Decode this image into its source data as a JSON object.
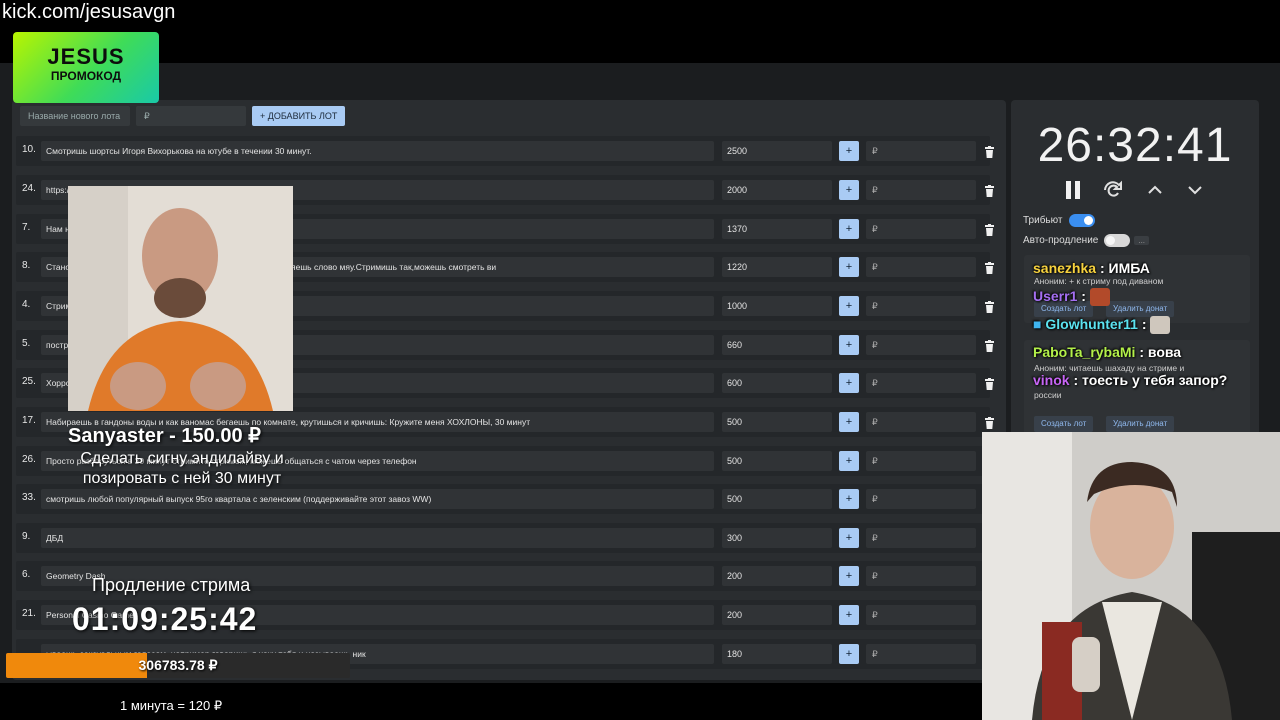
{
  "overlay": {
    "url": "kick.com/jesusavgn",
    "promo": {
      "line1": "JESUS",
      "line2": "ПРОМОКОД"
    }
  },
  "new_lot": {
    "name_placeholder": "Название нового лота",
    "amount_placeholder": "₽",
    "add_label": "+ ДОБАВИТЬ ЛОТ"
  },
  "lots": [
    {
      "rank": "10.",
      "title": "Смотришь шортсы Игоря Вихорькова на ютубе в течении 30 минут.",
      "amount": "2500",
      "plus": "+",
      "currency": "₽"
    },
    {
      "rank": "24.",
      "title": "https://",
      "amount": "2000",
      "plus": "+",
      "currency": "₽"
    },
    {
      "rank": "7.",
      "title": "Нам ну",
      "amount": "1370",
      "plus": "+",
      "currency": "₽"
    },
    {
      "rank": "8.",
      "title": "Станов                                                                                        вку и перед каждым или в конце предложения добавляешь слово мяу.Стримишь так,можешь смотреть ви",
      "amount": "1220",
      "plus": "+",
      "currency": "₽"
    },
    {
      "rank": "4.",
      "title": "Стрим",
      "amount": "1000",
      "plus": "+",
      "currency": "₽"
    },
    {
      "rank": "5.",
      "title": "постро",
      "amount": "660",
      "plus": "+",
      "currency": "₽"
    },
    {
      "rank": "25.",
      "title": "Хорро",
      "amount": "600",
      "plus": "+",
      "currency": "₽"
    },
    {
      "rank": "17.",
      "title": "Набираешь в гандоны воды и как ваномас бегаешь по комнате, крутишься и кричишь: Кружите меня ХОХЛОНЫ, 30 минут",
      "amount": "500",
      "plus": "+",
      "currency": "₽"
    },
    {
      "rank": "26.",
      "title": "Просто разберуться в 30 минут стримите стримом, можешь общаться с чатом через телефон",
      "amount": "500",
      "plus": "+",
      "currency": "₽"
    },
    {
      "rank": "33.",
      "title": "смотришь любой популярный выпуск 95го квартала с зеленским (поддерживайте этот завоз WW)",
      "amount": "500",
      "plus": "+",
      "currency": "₽"
    },
    {
      "rank": "9.",
      "title": "ДБД",
      "amount": "300",
      "plus": "+",
      "currency": "₽"
    },
    {
      "rank": "6.",
      "title": "Geometry Dash",
      "amount": "200",
      "plus": "+",
      "currency": "₽"
    },
    {
      "rank": "21.",
      "title": "Personal Casino Game",
      "amount": "200",
      "plus": "+",
      "currency": "₽"
    },
    {
      "rank": "",
      "title": "                                                                          ываешь сексуальным голосом, например говоришь я хочу тебя и называешь ник",
      "amount": "180",
      "plus": "+",
      "currency": "₽"
    }
  ],
  "timer": {
    "value": "26:32:41",
    "tribute_label": "Трибьют",
    "auto_extend_label": "Авто-продление",
    "more": "..."
  },
  "donations": [
    {
      "name": "Аноним:",
      "message": "+ к стриму под диваном",
      "create": "Создать лот",
      "delete": "Удалить донат"
    },
    {
      "name": "Аноним:",
      "message": "читаешь шахаду на стриме и",
      "message2": "россии",
      "create": "Создать лот",
      "delete": "Удалить донат"
    }
  ],
  "chat": [
    {
      "user": "sanezhka",
      "sep": ":",
      "text": "ИМБА",
      "color": "#f7d23e"
    },
    {
      "user": "Userr1",
      "sep": ":",
      "text": "",
      "color": "#a56ff2"
    },
    {
      "user": "Glowhunter11",
      "sep": ":",
      "text": "",
      "color": "#5be3f0"
    },
    {
      "user": "PaboTa_rybaMi",
      "sep": ":",
      "text": "вова",
      "color": "#b3f04a"
    },
    {
      "user": "vinok",
      "sep": ":",
      "text": "тоесть у тебя запор?",
      "color": "#c765f5"
    }
  ],
  "alert": {
    "donor": "Sanyaster - 150.00 ₽",
    "message": "Сделать сигну эндилайву и позировать с ней 30 минут"
  },
  "extension": {
    "label": "Продление стрима",
    "time": "01:09:25:42",
    "total": "306783.78 ₽",
    "progress_fraction": 0.41,
    "rate": "1 минута = 120 ₽"
  },
  "colors": {
    "accent": "#a9cbf4",
    "progress": "#f0890c",
    "toggle_on": "#3a8ef0"
  }
}
